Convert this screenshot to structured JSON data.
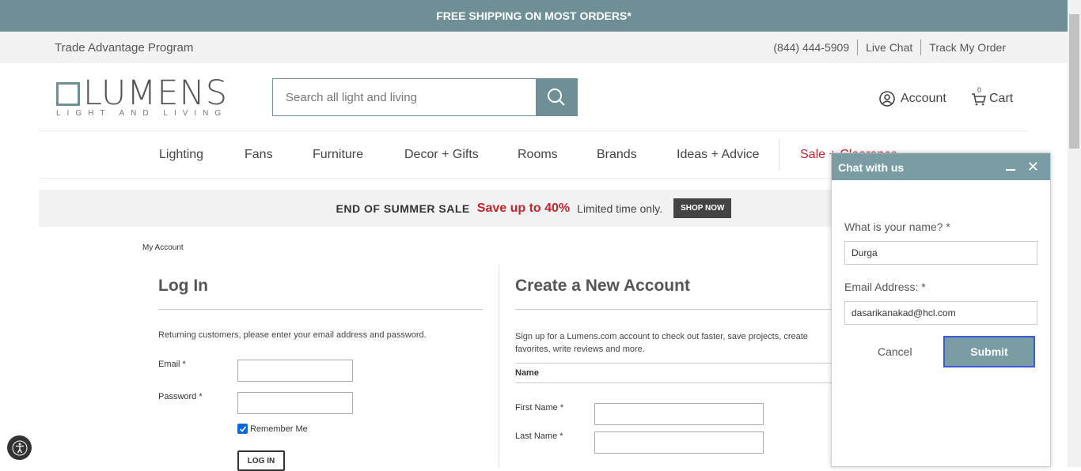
{
  "promo_bar": {
    "text": "FREE SHIPPING ON MOST ORDERS*"
  },
  "util": {
    "trade": "Trade Advantage Program",
    "phone": "(844) 444-5909",
    "live_chat": "Live Chat",
    "track": "Track My Order"
  },
  "header": {
    "logo": "LUMENS",
    "logo_sub": "LIGHT AND LIVING",
    "search_placeholder": "Search all light and living",
    "account": "Account",
    "cart": "Cart",
    "cart_count": "0"
  },
  "nav": [
    "Lighting",
    "Fans",
    "Furniture",
    "Decor + Gifts",
    "Rooms",
    "Brands",
    "Ideas + Advice",
    "Sale + Clearance"
  ],
  "banner": {
    "headline": "END OF SUMMER SALE",
    "offer": "Save up to 40%",
    "note": "Limited time only.",
    "cta": "SHOP NOW"
  },
  "breadcrumb": "My Account",
  "login": {
    "title": "Log In",
    "desc": "Returning customers, please enter your email address and password.",
    "email_label": "Email *",
    "password_label": "Password *",
    "remember": "Remember Me",
    "button": "LOG IN"
  },
  "create": {
    "title": "Create a New Account",
    "desc": "Sign up for a Lumens.com account to check out faster, save projects, create favorites, write reviews and more.",
    "section": "Name",
    "first_label": "First Name *",
    "last_label": "Last Name *"
  },
  "chat": {
    "title": "Chat with us",
    "name_label": "What is your name? *",
    "name_value": "Durga",
    "email_label": "Email Address: *",
    "email_value": "dasarikanakad@hcl.com",
    "cancel": "Cancel",
    "submit": "Submit"
  },
  "colors": {
    "brand": "#6e8f96",
    "sale": "#c0272d",
    "chat_header": "#7a9da4"
  }
}
